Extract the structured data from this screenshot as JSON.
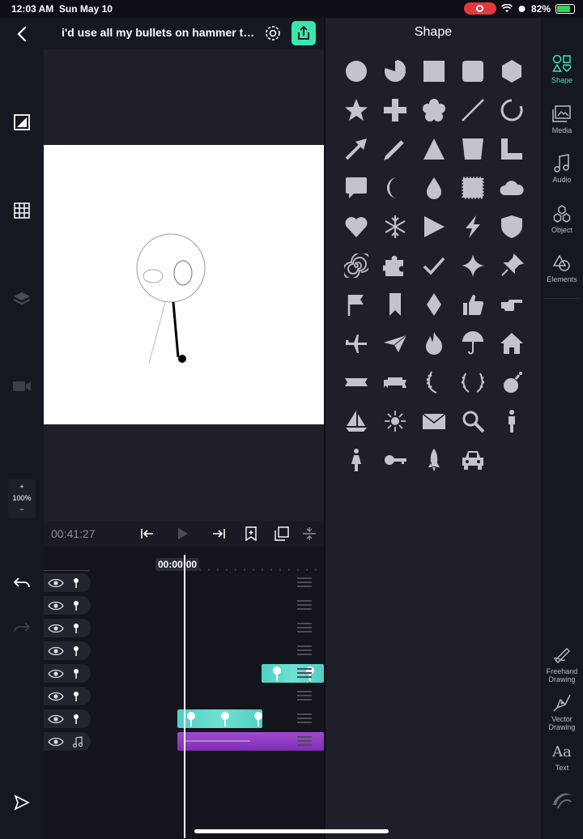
{
  "status_bar": {
    "time": "12:03 AM",
    "date": "Sun May 10",
    "battery": "82%"
  },
  "header": {
    "project_title": "i'd use all my bullets on hammer time"
  },
  "zoom": {
    "plus": "+",
    "level": "100%",
    "minus": "−"
  },
  "timeline": {
    "current_time": "00:41:27",
    "playhead_time": "00:00:00",
    "layers": [
      {
        "type": "shape"
      },
      {
        "type": "shape"
      },
      {
        "type": "shape"
      },
      {
        "type": "shape"
      },
      {
        "type": "shape"
      },
      {
        "type": "shape"
      },
      {
        "type": "shape"
      },
      {
        "type": "audio"
      }
    ]
  },
  "shape_panel": {
    "title": "Shape",
    "shapes": [
      "circle",
      "pie",
      "square",
      "rounded-square",
      "hexagon",
      "star",
      "plus",
      "flower",
      "line",
      "arc",
      "arrow",
      "pencil",
      "triangle",
      "trapezoid",
      "rounded-corner",
      "speech-bubble",
      "crescent",
      "drop",
      "stamp",
      "cloud",
      "heart",
      "snowflake",
      "play",
      "lightning",
      "shield",
      "spiral",
      "puzzle",
      "checkmark",
      "sparkle",
      "pushpin",
      "flag",
      "bookmark",
      "diamond",
      "thumbs-up",
      "pointing-hand",
      "airplane",
      "paper-plane",
      "flame",
      "umbrella",
      "house",
      "ribbon",
      "banner",
      "laurel-left",
      "laurel",
      "bomb",
      "sailboat",
      "sun",
      "envelope",
      "magnifier",
      "man",
      "woman",
      "key",
      "rocket",
      "car"
    ]
  },
  "right_rail": {
    "tabs": [
      "Shape",
      "Media",
      "Audio",
      "Object",
      "Elements"
    ],
    "tools": [
      "Freehand Drawing",
      "Vector Drawing",
      "Text"
    ]
  },
  "colors": {
    "accent": "#3be5b0",
    "teal_clip": "#4fcfc6",
    "audio_clip": "#9a3fcf",
    "panel": "#1e1f28"
  }
}
